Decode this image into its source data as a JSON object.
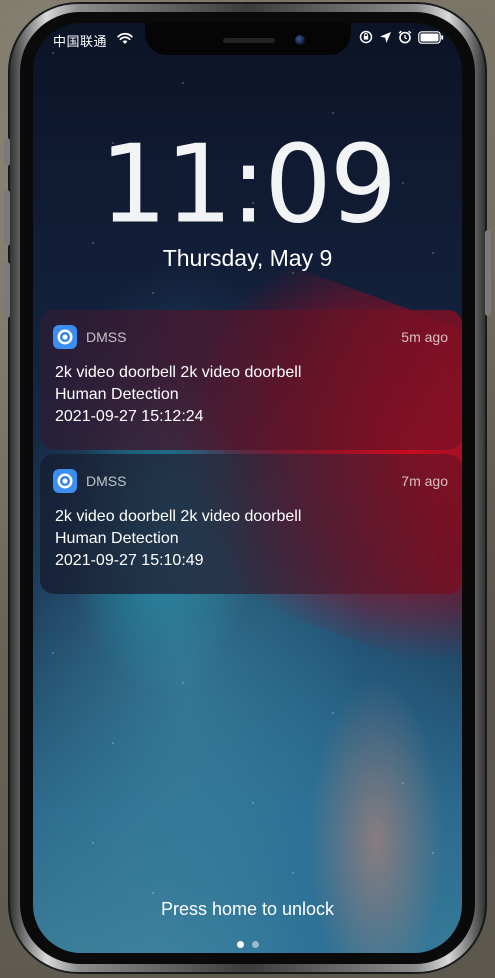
{
  "status_bar": {
    "carrier": "中国联通",
    "icons": [
      "wifi-icon",
      "lock-rotation-icon",
      "location-arrow-icon",
      "alarm-icon",
      "battery-icon"
    ]
  },
  "lock_screen": {
    "time": "11:09",
    "date": "Thursday, May 9",
    "unlock_hint": "Press home to unlock",
    "page_dots": 2,
    "active_dot": 1
  },
  "notifications": [
    {
      "app": "DMSS",
      "time_ago": "5m ago",
      "line1": "2k video doorbell 2k video doorbell",
      "line2": "Human Detection",
      "line3": "2021-09-27 15:12:24"
    },
    {
      "app": "DMSS",
      "time_ago": "7m ago",
      "line1": "2k video doorbell 2k video doorbell",
      "line2": "Human Detection",
      "line3": "2021-09-27 15:10:49"
    }
  ],
  "colors": {
    "app_icon": "#3c8ef0",
    "text": "#ffffff",
    "secondary_text": "#b8b8b8"
  }
}
